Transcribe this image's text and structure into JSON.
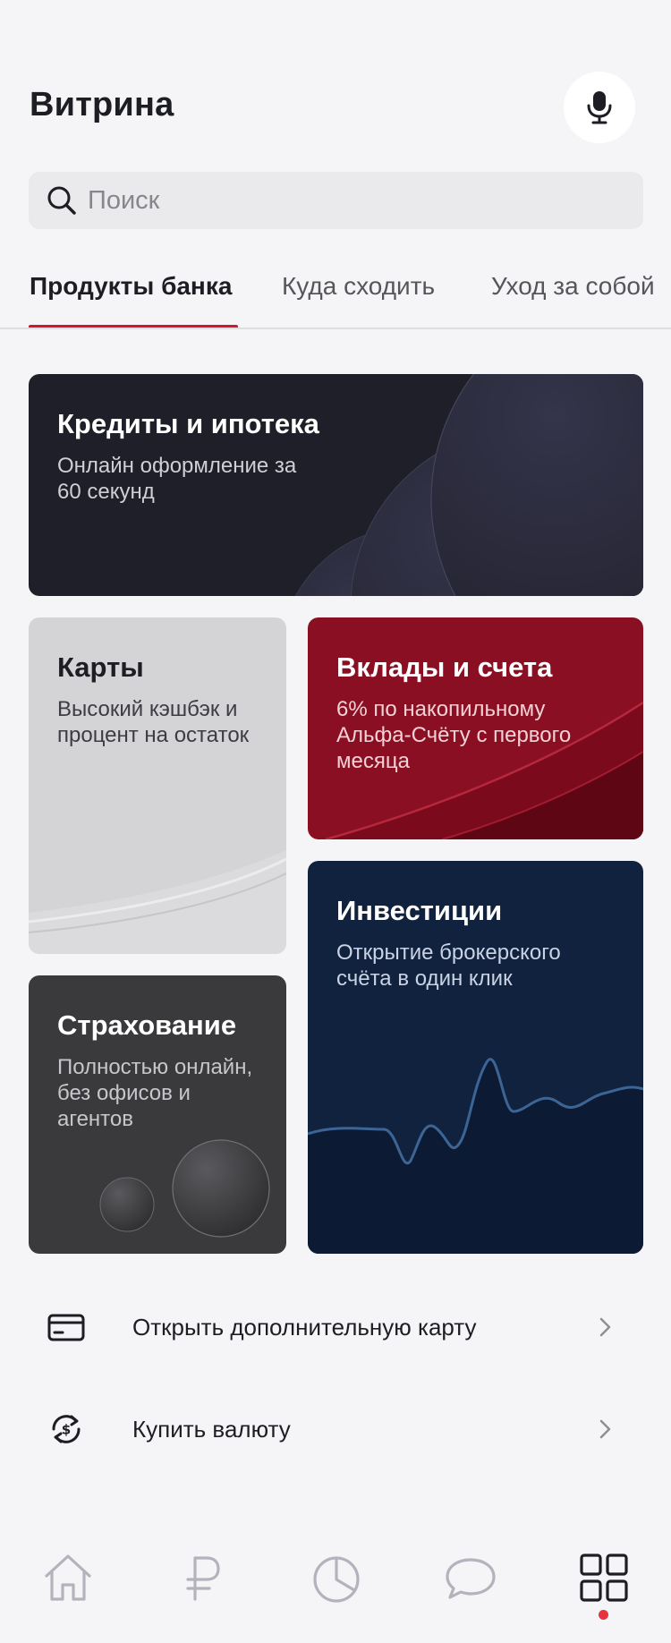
{
  "header": {
    "title": "Витрина",
    "mic_icon": "microphone-icon"
  },
  "search": {
    "placeholder": "Поиск",
    "value": "",
    "icon": "search-icon"
  },
  "tabs": [
    {
      "label": "Продукты банка",
      "active": true
    },
    {
      "label": "Куда сходить",
      "active": false
    },
    {
      "label": "Уход за собой",
      "active": false
    }
  ],
  "cards": {
    "credit": {
      "title": "Кредиты и ипотека",
      "desc": "Онлайн оформление за 60 секунд"
    },
    "cards": {
      "title": "Карты",
      "desc": "Высокий кэшбэк и процент на остаток"
    },
    "deposits": {
      "title": "Вклады и счета",
      "desc": "6% по накопильному Альфа-Счёту с первого месяца"
    },
    "invest": {
      "title": "Инвестиции",
      "desc": "Открытие брокерского счёта в один клик"
    },
    "insurance": {
      "title": "Страхование",
      "desc": "Полностью онлайн, без офисов и агентов"
    }
  },
  "list": [
    {
      "label": "Открыть дополнительную карту",
      "icon": "card-icon"
    },
    {
      "label": "Купить валюту",
      "icon": "currency-exchange-icon"
    }
  ],
  "bottom_nav": [
    {
      "name": "home",
      "icon": "home-icon",
      "active": false
    },
    {
      "name": "payments",
      "icon": "ruble-icon",
      "active": false
    },
    {
      "name": "history",
      "icon": "pie-chart-icon",
      "active": false
    },
    {
      "name": "chat",
      "icon": "chat-icon",
      "active": false
    },
    {
      "name": "showcase",
      "icon": "grid-icon",
      "active": true,
      "notification_dot": true
    }
  ],
  "colors": {
    "accent": "#d7142e",
    "background": "#f5f5f7",
    "credit_card": "#1f1f2a",
    "cards_card": "#d4d4d6",
    "deposits_card": "#8a0f22",
    "invest_card": "#10223d",
    "insurance_card": "#3a3a3c"
  }
}
